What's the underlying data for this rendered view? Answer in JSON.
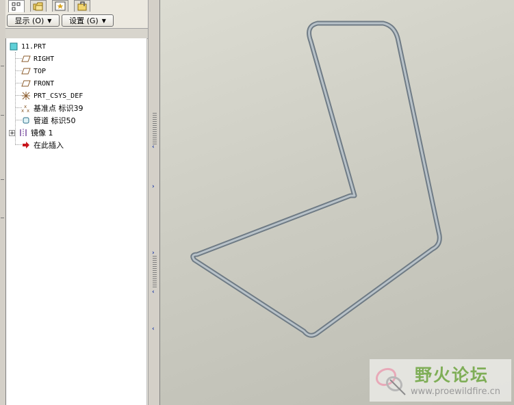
{
  "toolbar": {
    "show_label": "显示 (O)",
    "settings_label": "设置 (G)"
  },
  "tree": {
    "root": "11.PRT",
    "items": [
      {
        "label": "RIGHT",
        "icon": "datum-plane-icon"
      },
      {
        "label": "TOP",
        "icon": "datum-plane-icon"
      },
      {
        "label": "FRONT",
        "icon": "datum-plane-icon"
      },
      {
        "label": "PRT_CSYS_DEF",
        "icon": "csys-icon"
      },
      {
        "label": "基准点 标识39",
        "icon": "datum-point-icon"
      },
      {
        "label": "管道 标识50",
        "icon": "pipe-icon"
      },
      {
        "label": "镜像 1",
        "icon": "mirror-icon"
      },
      {
        "label": "在此插入",
        "icon": "insert-here-icon"
      }
    ]
  },
  "watermark": {
    "title": "野火论坛",
    "url": "www.proewildfire.cn"
  },
  "colors": {
    "accent": "#2440a8",
    "viewport_bg": "#cdcdc3",
    "model_stroke": "#7f8c96",
    "plane_icon": "#8a5a2a",
    "insert_arrow": "#c8161d",
    "watermark_green": "#7fae57"
  }
}
